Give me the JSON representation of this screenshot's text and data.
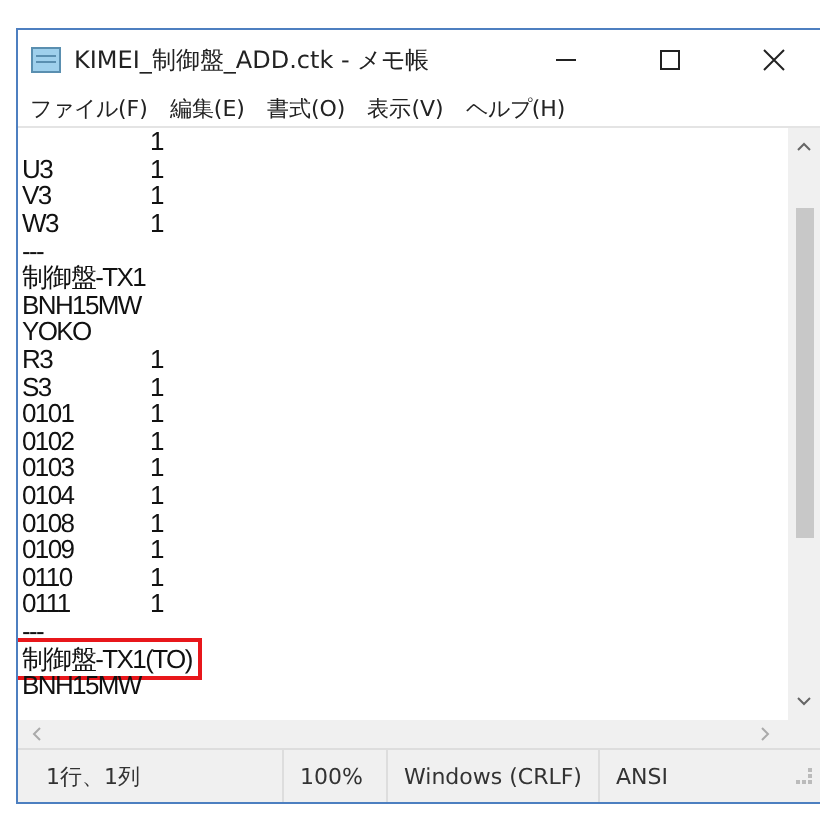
{
  "window": {
    "title": "KIMEI_制御盤_ADD.ctk - メモ帳"
  },
  "menu": [
    "ファイル(F)",
    "編集(E)",
    "書式(O)",
    "表示(V)",
    "ヘルプ(H)"
  ],
  "lines": [
    {
      "value": "1"
    },
    {
      "name": "U3",
      "value": "1"
    },
    {
      "name": "V3",
      "value": "1"
    },
    {
      "name": "W3",
      "value": "1"
    },
    {
      "name": "---"
    },
    {
      "name": "制御盤-TX1"
    },
    {
      "name": "BNH15MW"
    },
    {
      "name": "YOKO"
    },
    {
      "name": "R3",
      "value": "1"
    },
    {
      "name": "S3",
      "value": "1"
    },
    {
      "name": "0101",
      "value": "1"
    },
    {
      "name": "0102",
      "value": "1"
    },
    {
      "name": "0103",
      "value": "1"
    },
    {
      "name": "0104",
      "value": "1"
    },
    {
      "name": "0108",
      "value": "1"
    },
    {
      "name": "0109",
      "value": "1"
    },
    {
      "name": "0110",
      "value": "1"
    },
    {
      "name": "0111",
      "value": "1"
    },
    {
      "name": "---"
    },
    {
      "name": "制御盤-TX1(TO)",
      "highlighted": true
    },
    {
      "name": "BNH15MW"
    }
  ],
  "status_bar": [
    "1行、1列",
    "100%",
    "Windows (CRLF)",
    "ANSI"
  ]
}
